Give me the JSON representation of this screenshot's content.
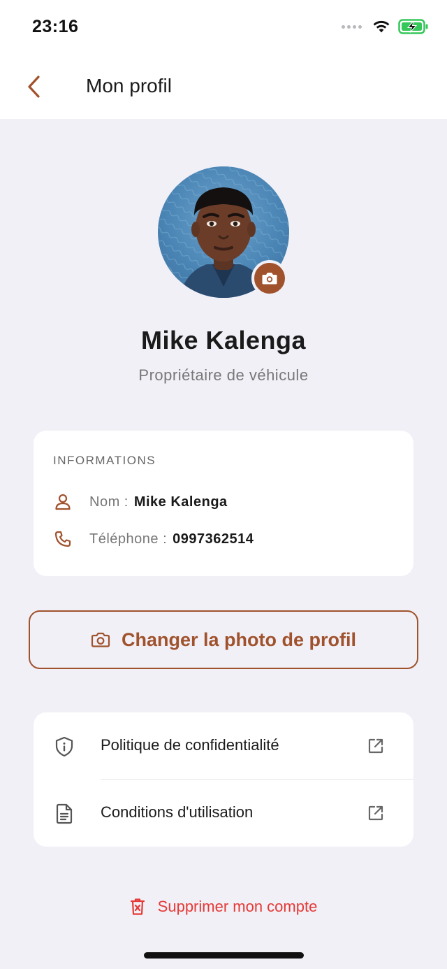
{
  "status_bar": {
    "time": "23:16",
    "icons": [
      "signal-dots-icon",
      "wifi-icon",
      "battery-charging-icon"
    ],
    "battery_color": "#34c759"
  },
  "header": {
    "title": "Mon profil",
    "back_icon": "chevron-left-icon"
  },
  "profile": {
    "name": "Mike Kalenga",
    "role": "Propriétaire de véhicule",
    "avatar_badge_icon": "camera-icon"
  },
  "info_card": {
    "heading": "INFORMATIONS",
    "rows": [
      {
        "icon": "person-icon",
        "label": "Nom :",
        "value": "Mike Kalenga"
      },
      {
        "icon": "phone-icon",
        "label": "Téléphone :",
        "value": "0997362514"
      }
    ]
  },
  "change_photo_button": {
    "icon": "camera-icon",
    "label": "Changer la photo de profil"
  },
  "links": [
    {
      "icon": "shield-info-icon",
      "label": "Politique de confidentialité",
      "trailing_icon": "external-link-icon"
    },
    {
      "icon": "document-icon",
      "label": "Conditions d'utilisation",
      "trailing_icon": "external-link-icon"
    }
  ],
  "delete_account": {
    "icon": "trash-icon",
    "label": "Supprimer mon compte"
  },
  "colors": {
    "accent": "#a0522d",
    "danger": "#e53935",
    "background": "#f1f0f7",
    "card": "#ffffff"
  }
}
